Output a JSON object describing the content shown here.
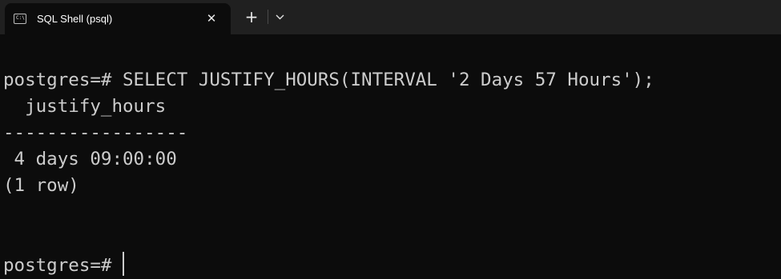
{
  "window": {
    "tab_title": "SQL Shell (psql)",
    "tab_icon_glyph": "C:\\",
    "close_glyph": "✕",
    "new_tab_glyph": "+",
    "icons": {
      "tab": "console-icon",
      "close": "close-icon",
      "new_tab": "plus-icon",
      "dropdown": "chevron-down-icon"
    }
  },
  "terminal": {
    "lines": [
      "postgres=# SELECT JUSTIFY_HOURS(INTERVAL '2 Days 57 Hours');",
      "  justify_hours",
      "-----------------",
      " 4 days 09:00:00",
      "(1 row)",
      "",
      "",
      "postgres=# "
    ]
  },
  "colors": {
    "terminal_bg": "#0c0c0c",
    "titlebar_bg": "#202020",
    "text": "#cccccc"
  }
}
